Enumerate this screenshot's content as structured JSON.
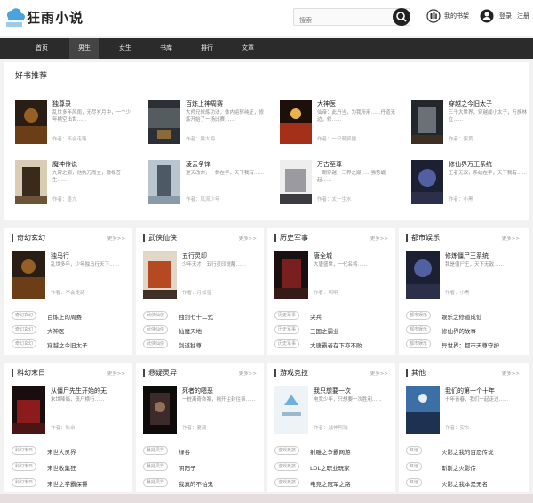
{
  "header": {
    "site_name": "狂雨小说",
    "search_placeholder": "搜索",
    "shelf_label": "我的书架",
    "login_label": "登录",
    "register_label": "注册"
  },
  "nav": [
    "首页",
    "男生",
    "女生",
    "书库",
    "排行",
    "文章"
  ],
  "recommend": {
    "title": "好书推荐",
    "books": [
      {
        "title": "独尊录",
        "desc": "乱世多年风雨，无尽岁月中，一个少年横空出世……",
        "author": "作者：不会走路"
      },
      {
        "title": "百炼上神周赛",
        "desc": "大师兄修炼功法，体内运转纯正，修炼开始了一场比赛……",
        "author": "作者：胖大海"
      },
      {
        "title": "大神医",
        "desc": "仙帝：此丹当，为我所用……丹道无边，修……",
        "author": "作者：一只萌狐狸"
      },
      {
        "title": "穿越之今旧太子",
        "desc": "三千大世界，穿越成小太子，万族林立……",
        "author": "作者：蛋黄"
      },
      {
        "title": "魔神传说",
        "desc": "九霄之巅，他执刀而立，傲视苍生……",
        "author": "作者：墨九"
      },
      {
        "title": "凌云争锋",
        "desc": "逆天改命，一剑在手，天下我有……",
        "author": "作者：风流少年"
      },
      {
        "title": "万古至尊",
        "desc": "一朝穿越，三界之巅……强势崛起……",
        "author": "作者：太一生水"
      },
      {
        "title": "修仙界万王系统",
        "desc": "王者无双，系统在手，天下我有……",
        "author": "作者：小黑"
      }
    ]
  },
  "categories": [
    {
      "title": "奇幻玄幻",
      "more": "更多>>",
      "feature": {
        "title": "独马行",
        "desc": "乱世多年，少年独马行天下……",
        "author": "作者：不会走路"
      },
      "items": [
        {
          "tag": "奇幻玄幻",
          "title": "百炼上的周赛"
        },
        {
          "tag": "奇幻玄幻",
          "title": "大神医"
        },
        {
          "tag": "奇幻玄幻",
          "title": "穿越之今旧太子"
        }
      ]
    },
    {
      "title": "武侠仙侠",
      "more": "更多>>",
      "feature": {
        "title": "五行灵印",
        "desc": "少年天才，五行灵印觉醒……",
        "author": "作者：月如雪"
      },
      "items": [
        {
          "tag": "武侠仙侠",
          "title": "独剑七十二式"
        },
        {
          "tag": "武侠仙侠",
          "title": "仙魔天地"
        },
        {
          "tag": "武侠仙侠",
          "title": "剑道独尊"
        }
      ]
    },
    {
      "title": "历史军事",
      "more": "更多>>",
      "feature": {
        "title": "唐全城",
        "desc": "大唐盛世，一代名将……",
        "author": "作者：明明"
      },
      "items": [
        {
          "tag": "历史军事",
          "title": "尖兵"
        },
        {
          "tag": "历史军事",
          "title": "三国之霸业"
        },
        {
          "tag": "历史军事",
          "title": "大唐霸者在下亦不败"
        }
      ]
    },
    {
      "title": "都市娱乐",
      "more": "更多>>",
      "feature": {
        "title": "修炼僵尸王系统",
        "desc": "我是僵尸王，天下无敌……",
        "author": "作者：小黑"
      },
      "items": [
        {
          "tag": "都市娱乐",
          "title": "娱乐之修道成仙"
        },
        {
          "tag": "都市娱乐",
          "title": "修仙界的故事"
        },
        {
          "tag": "都市娱乐",
          "title": "异世界：都市天尊守护"
        }
      ]
    },
    {
      "title": "科幻末日",
      "more": "更多>>",
      "feature": {
        "title": "从僵尸先生开始的无",
        "desc": "末世降临，丧尸横行……",
        "author": "作者：陈余"
      },
      "items": [
        {
          "tag": "科幻末日",
          "title": "末世大灵界"
        },
        {
          "tag": "科幻末日",
          "title": "末世收集狂"
        },
        {
          "tag": "科幻末日",
          "title": "末世之学霸保镖"
        }
      ]
    },
    {
      "title": "悬疑灵异",
      "more": "更多>>",
      "feature": {
        "title": "死者的嗯恶",
        "desc": "一桩离奇命案，揭开尘封往事……",
        "author": "作者：夏丽"
      },
      "items": [
        {
          "tag": "悬疑灵异",
          "title": "绿谷"
        },
        {
          "tag": "悬疑灵异",
          "title": "阴阳子"
        },
        {
          "tag": "悬疑灵异",
          "title": "我真的不怕鬼"
        }
      ]
    },
    {
      "title": "游戏竞技",
      "more": "更多>>",
      "feature": {
        "title": "我只想要一次",
        "desc": "电竞少年，只想要一次胜利……",
        "author": "作者：战神阿瑞"
      },
      "items": [
        {
          "tag": "游戏竞技",
          "title": "射雕之争霸网游"
        },
        {
          "tag": "游戏竞技",
          "title": "LOL之职业玩家"
        },
        {
          "tag": "游戏竞技",
          "title": "电竞之冠军之路"
        }
      ]
    },
    {
      "title": "其他",
      "more": "更多>>",
      "feature": {
        "title": "我们的第一个十年",
        "desc": "十年青春，我们一起走过……",
        "author": "作者：安东"
      },
      "items": [
        {
          "tag": "其他",
          "title": "火影之我的百忍传说"
        },
        {
          "tag": "其他",
          "title": "斯斯之火影传"
        },
        {
          "tag": "其他",
          "title": "火影之我本是无名"
        }
      ]
    }
  ],
  "colors": {
    "nav_bg": "#2b2b2b",
    "accent": "#222222"
  }
}
